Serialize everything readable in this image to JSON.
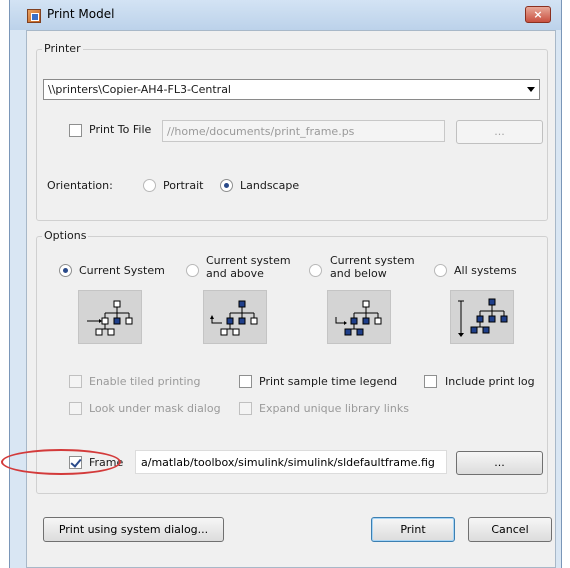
{
  "window": {
    "title": "Print Model",
    "close_label": "×"
  },
  "printer": {
    "group_label": "Printer",
    "selected": "\\\\printers\\Copier-AH4-FL3-Central",
    "print_to_file": {
      "label": "Print To File",
      "checked": false
    },
    "file_path": "//home/documents/print_frame.ps",
    "browse_label": "...",
    "orientation_label": "Orientation:",
    "portrait_label": "Portrait",
    "landscape_label": "Landscape",
    "orientation_selected": "Landscape"
  },
  "options": {
    "group_label": "Options",
    "system_choices": [
      {
        "label": "Current System",
        "selected": true
      },
      {
        "label_line1": "Current system",
        "label_line2": "and above",
        "selected": false
      },
      {
        "label_line1": "Current system",
        "label_line2": "and below",
        "selected": false
      },
      {
        "label": "All systems",
        "selected": false
      }
    ],
    "enable_tiled_label": "Enable tiled printing",
    "print_sample_time_label": "Print sample time legend",
    "include_print_log_label": "Include print log",
    "look_under_mask_label": "Look under mask dialog",
    "expand_unique_label": "Expand unique library links",
    "frame": {
      "label": "Frame",
      "checked": true,
      "path": "a/matlab/toolbox/simulink/simulink/sldefaultframe.fig",
      "browse_label": "..."
    }
  },
  "buttons": {
    "system_dialog": "Print using system dialog...",
    "print": "Print",
    "cancel": "Cancel"
  },
  "colors": {
    "titlebar": "#bcd2ea",
    "client": "#f0f0f0",
    "highlight": "#d33a3a",
    "block_blue": "#1f3f8a"
  }
}
